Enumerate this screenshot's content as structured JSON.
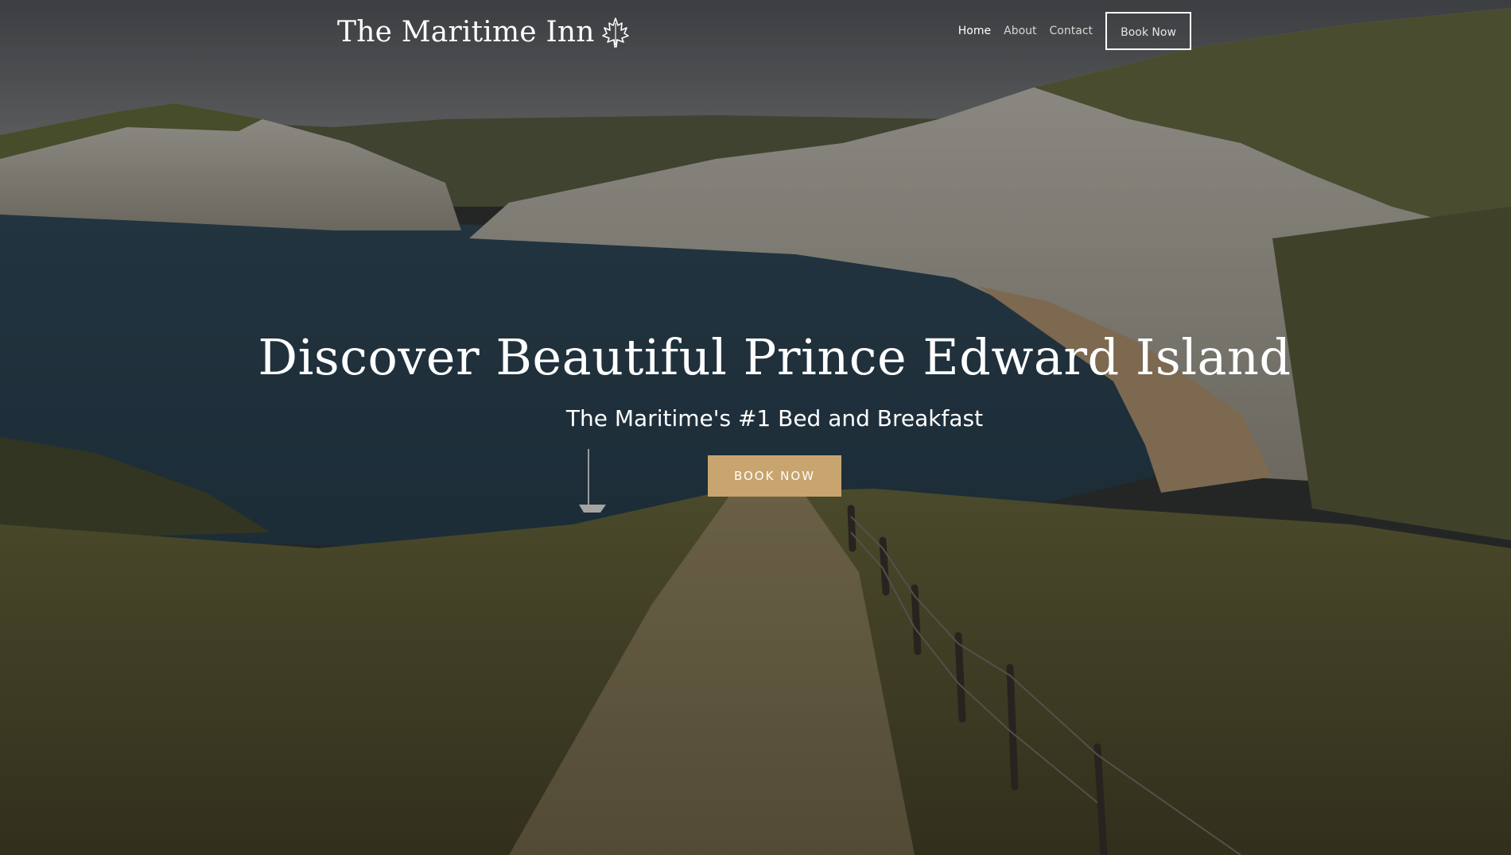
{
  "header": {
    "brand_name": "The Maritime Inn",
    "brand_icon": "maple-leaf-icon"
  },
  "nav": {
    "items": [
      {
        "label": "Home",
        "active": true
      },
      {
        "label": "About",
        "active": false
      },
      {
        "label": "Contact",
        "active": false
      }
    ],
    "cta_label": "Book Now"
  },
  "hero": {
    "headline": "Discover Beautiful Prince Edward Island",
    "subheadline": "The Maritime's #1 Bed and Breakfast",
    "cta_label": "BOOK NOW",
    "background": "coastal-cliffs-grass-path-photo"
  },
  "colors": {
    "accent": "#c8a46e",
    "text": "#ffffff",
    "overlay": "#141618"
  }
}
